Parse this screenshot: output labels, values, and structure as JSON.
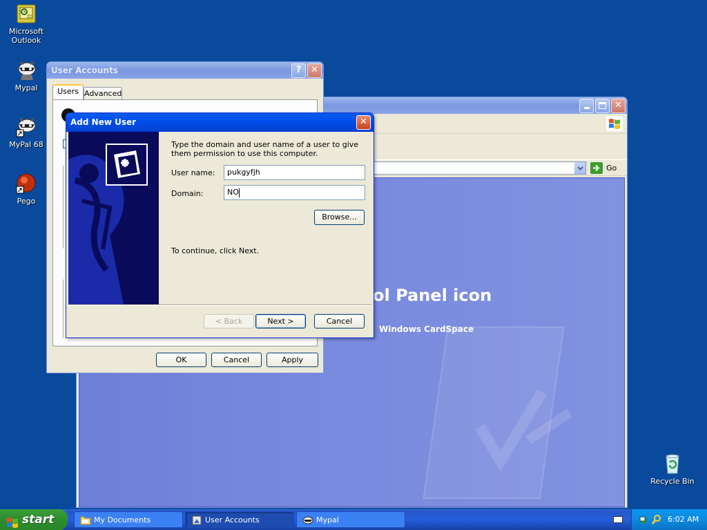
{
  "desktop": {
    "icons": [
      {
        "label1": "Microsoft",
        "label2": "Outlook"
      },
      {
        "label1": "Mypal",
        "label2": ""
      },
      {
        "label1": "MyPal 68",
        "label2": ""
      },
      {
        "label1": "Pego",
        "label2": ""
      },
      {
        "label1": "Recycle Bin",
        "label2": ""
      }
    ]
  },
  "control_panel": {
    "go_label": "Go",
    "heading": "ol Panel icon",
    "link": "Windows CardSpace"
  },
  "user_accounts": {
    "title": "User Accounts",
    "tabs": [
      "Users",
      "Advanced"
    ],
    "ok": "OK",
    "cancel": "Cancel",
    "apply": "Apply"
  },
  "add_user": {
    "title": "Add New User",
    "instructions": "Type the domain and user name of a user to give them permission to use this computer.",
    "username_label": "User name:",
    "username_value": "pukgyfjh",
    "domain_label": "Domain:",
    "domain_value": "NO",
    "browse": "Browse...",
    "continue_text": "To continue, click Next.",
    "back": "< Back",
    "next": "Next >",
    "cancel": "Cancel"
  },
  "taskbar": {
    "start": "start",
    "tasks": [
      "My Documents",
      "User Accounts",
      "Mypal"
    ],
    "clock": "6:02 AM"
  }
}
